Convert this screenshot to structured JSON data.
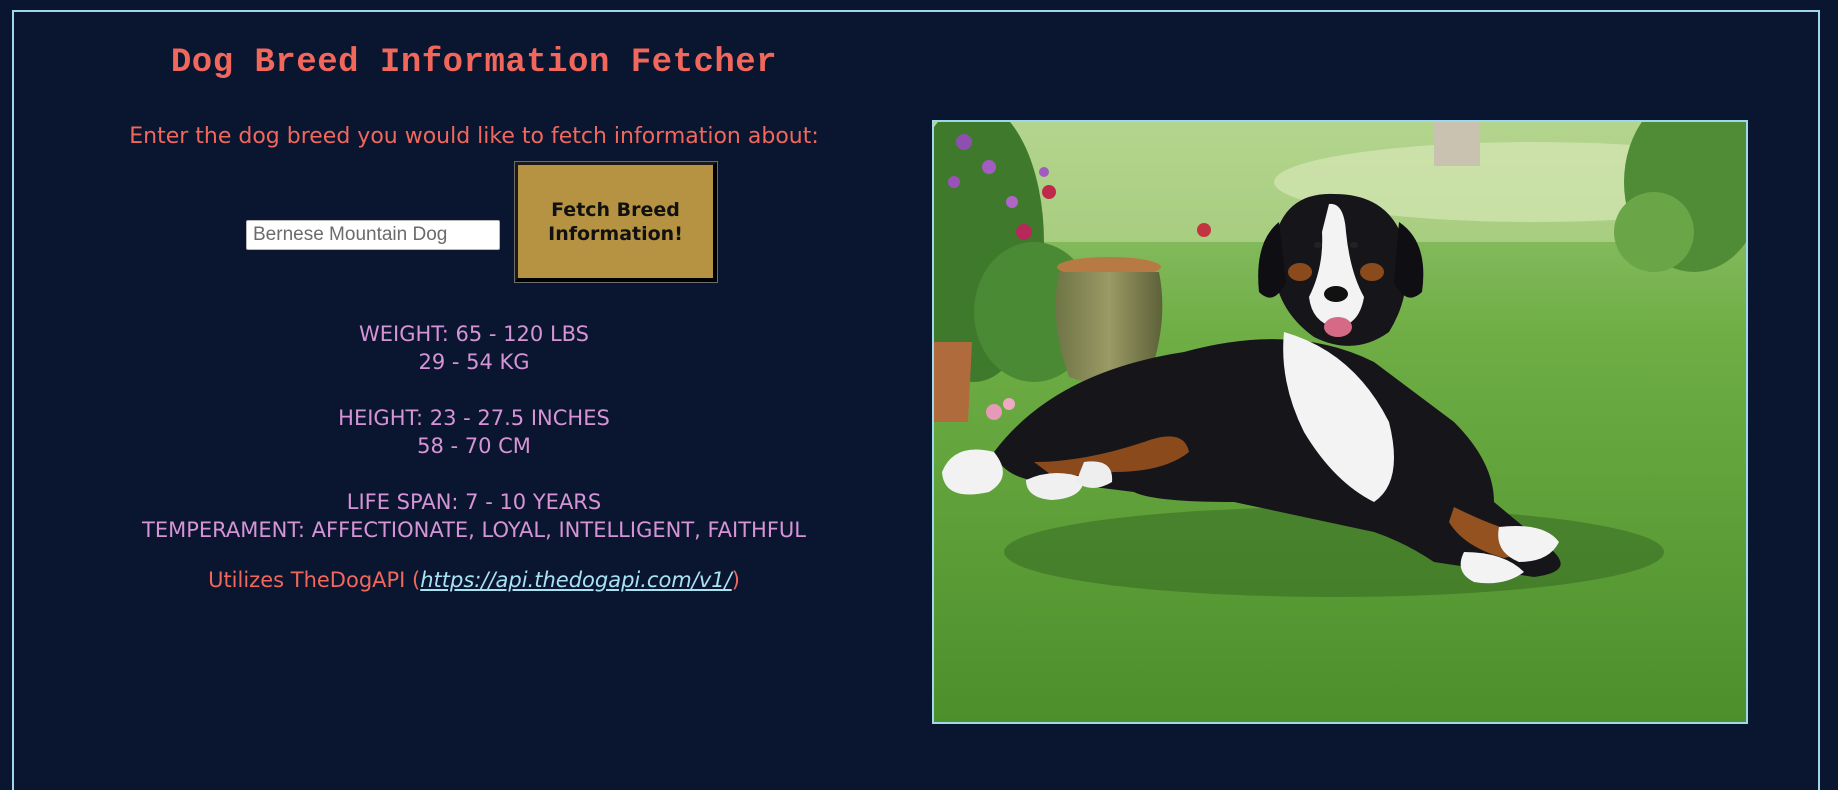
{
  "app": {
    "title": "Dog Breed Information Fetcher",
    "prompt": "Enter the dog breed you would like to fetch information about:"
  },
  "search": {
    "value": "Bernese Mountain Dog",
    "button_label": "Fetch Breed\nInformation!"
  },
  "breed_info": {
    "weight_imperial": "WEIGHT: 65 - 120 LBS",
    "weight_metric": "29 - 54 KG",
    "height_imperial": "HEIGHT: 23 - 27.5 INCHES",
    "height_metric": "58 - 70 CM",
    "life_span": "LIFE SPAN: 7 - 10 YEARS",
    "temperament": "TEMPERAMENT: AFFECTIONATE, LOYAL, INTELLIGENT, FAITHFUL"
  },
  "credit": {
    "prefix": "Utilizes TheDogAPI (",
    "link_text": "https://api.thedogapi.com/v1/",
    "suffix": ")"
  },
  "colors": {
    "background": "#0a1630",
    "accent_red": "#f1675c",
    "info_pink": "#d694d6",
    "link_blue": "#a9e2f3",
    "button_gold": "#b59342",
    "border_cyan": "#9fd7ec"
  },
  "image": {
    "subject": "dog-photo"
  }
}
